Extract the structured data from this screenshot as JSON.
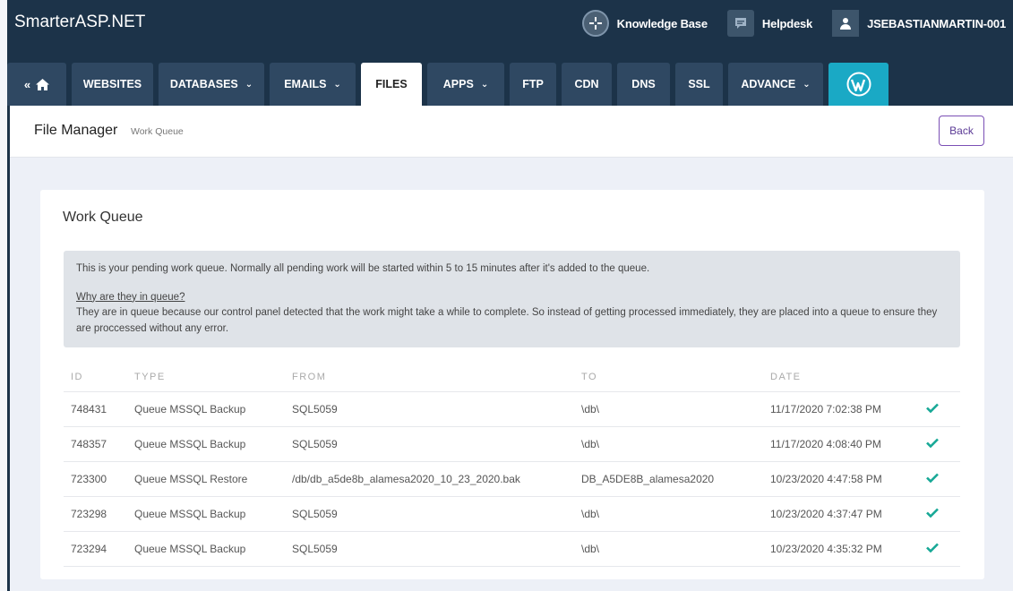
{
  "brand": "SmarterASP.NET",
  "top_links": {
    "knowledge_base": "Knowledge Base",
    "helpdesk": "Helpdesk",
    "user": "JSEBASTIANMARTIN-001"
  },
  "nav": {
    "tabs": [
      {
        "label": "WEBSITES",
        "dropdown": false
      },
      {
        "label": "DATABASES",
        "dropdown": true
      },
      {
        "label": "EMAILS",
        "dropdown": true
      },
      {
        "label": "FILES",
        "dropdown": false
      },
      {
        "label": "APPS",
        "dropdown": true
      },
      {
        "label": "FTP",
        "dropdown": false
      },
      {
        "label": "CDN",
        "dropdown": false
      },
      {
        "label": "DNS",
        "dropdown": false
      },
      {
        "label": "SSL",
        "dropdown": false
      },
      {
        "label": "ADVANCE",
        "dropdown": true
      }
    ],
    "active": "FILES"
  },
  "subheader": {
    "title": "File Manager",
    "breadcrumb": "Work Queue",
    "back_label": "Back"
  },
  "card": {
    "title": "Work Queue",
    "info_line1": "This is your pending work queue. Normally all pending work will be started within 5 to 15 minutes after it's added to the queue.",
    "info_link": "Why are they in queue?",
    "info_line2": "They are in queue because our control panel detected that the work might take a while to complete. So instead of getting processed immediately, they are placed into a queue to ensure they are proccessed without any error."
  },
  "table": {
    "headers": {
      "id": "ID",
      "type": "TYPE",
      "from": "FROM",
      "to": "TO",
      "date": "DATE"
    },
    "rows": [
      {
        "id": "748431",
        "type": "Queue MSSQL Backup",
        "from": "SQL5059",
        "to": "\\db\\",
        "date": "11/17/2020 7:02:38 PM"
      },
      {
        "id": "748357",
        "type": "Queue MSSQL Backup",
        "from": "SQL5059",
        "to": "\\db\\",
        "date": "11/17/2020 4:08:40 PM"
      },
      {
        "id": "723300",
        "type": "Queue MSSQL Restore",
        "from": "/db/db_a5de8b_alamesa2020_10_23_2020.bak",
        "to": "DB_A5DE8B_alamesa2020",
        "date": "10/23/2020 4:47:58 PM"
      },
      {
        "id": "723298",
        "type": "Queue MSSQL Backup",
        "from": "SQL5059",
        "to": "\\db\\",
        "date": "10/23/2020 4:37:47 PM"
      },
      {
        "id": "723294",
        "type": "Queue MSSQL Backup",
        "from": "SQL5059",
        "to": "\\db\\",
        "date": "10/23/2020 4:35:32 PM"
      }
    ]
  },
  "colors": {
    "topbar": "#1c3349",
    "tab": "#2f4862",
    "wordpress": "#1aa9c5",
    "check": "#17a896",
    "back_border": "#7b4fb5"
  },
  "icons": {
    "home": "home-icon",
    "back_arrows": "double-chevron-left-icon",
    "wordpress": "wordpress-icon",
    "status": "checkmark-icon"
  }
}
